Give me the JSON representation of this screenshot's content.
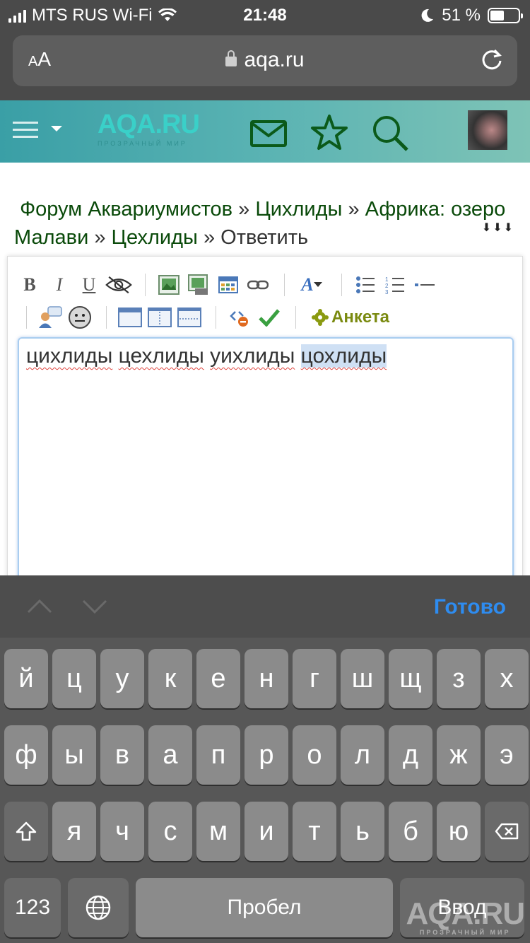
{
  "status_bar": {
    "carrier": "MTS RUS Wi-Fi",
    "time": "21:48",
    "battery_pct": "51 %",
    "battery_level": 0.51
  },
  "browser": {
    "text_size_label_small": "A",
    "text_size_label_big": "A",
    "url": "aqa.ru"
  },
  "site_header": {
    "logo_text": "AQA.RU",
    "logo_tagline": "ПРОЗРАЧНЫЙ МИР",
    "icons": [
      "menu-icon",
      "mail-icon",
      "star-icon",
      "search-icon"
    ]
  },
  "breadcrumb": {
    "items": [
      "Форум Аквариумистов",
      "Цихлиды",
      "Африка: озеро Малави",
      "Цехлиды"
    ],
    "current": "Ответить",
    "separator": "»",
    "arrows": "⬇⬇⬇"
  },
  "editor": {
    "toolbar_row1": [
      "bold",
      "italic",
      "underline",
      "hide",
      "image",
      "image-upload",
      "table",
      "link",
      "font-color",
      "bullet-list",
      "numbered-list",
      "hr"
    ],
    "bold": "B",
    "italic": "I",
    "underline": "U",
    "font_label": "A",
    "anketa_label": "Анкета",
    "words": [
      "цихлиды",
      "цехлиды",
      "уихлиды",
      "цохлиды"
    ],
    "selected_word_index": 3
  },
  "keyboard": {
    "done_label": "Готово",
    "row1": [
      "й",
      "ц",
      "у",
      "к",
      "е",
      "н",
      "г",
      "ш",
      "щ",
      "з",
      "х"
    ],
    "row2": [
      "ф",
      "ы",
      "в",
      "а",
      "п",
      "р",
      "о",
      "л",
      "д",
      "ж",
      "э"
    ],
    "row3": [
      "я",
      "ч",
      "с",
      "м",
      "и",
      "т",
      "ь",
      "б",
      "ю"
    ],
    "numbers_label": "123",
    "space_label": "Пробел",
    "enter_label": "Ввод"
  },
  "watermark": {
    "text": "AQA.RU",
    "tagline": "ПРОЗРАЧНЫЙ МИР"
  },
  "colors": {
    "header_gradient_start": "#3a9fa6",
    "header_gradient_end": "#7ec3b6",
    "breadcrumb_link": "#0a4a0a",
    "done_blue": "#2e8cf0",
    "spell_error": "#e0443e"
  }
}
